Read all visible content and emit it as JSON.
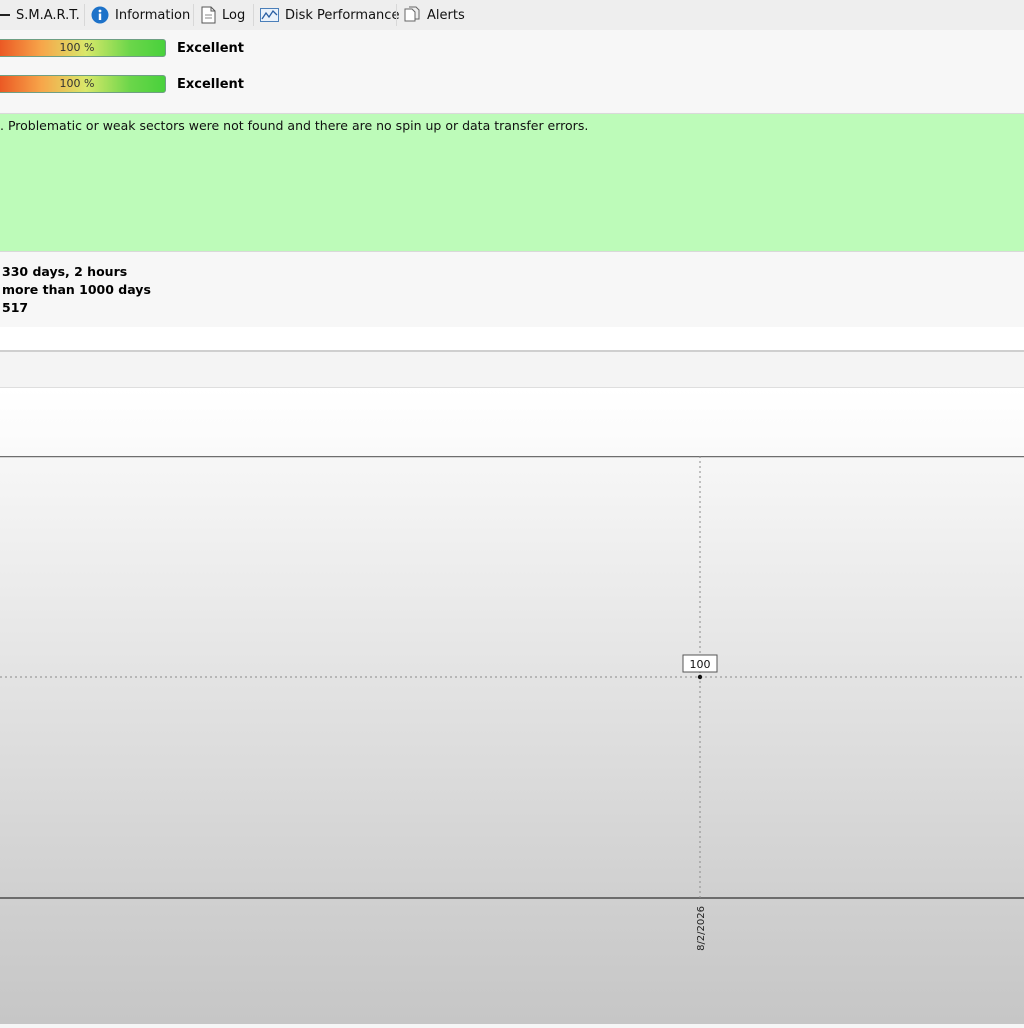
{
  "tabs": [
    {
      "label": "S.M.A.R.T.",
      "icon": "dash-icon"
    },
    {
      "label": "Information",
      "icon": "info-icon"
    },
    {
      "label": "Log",
      "icon": "document-icon"
    },
    {
      "label": "Disk Performance",
      "icon": "performance-chart-icon"
    },
    {
      "label": "Alerts",
      "icon": "alerts-icon"
    }
  ],
  "health": {
    "bars": [
      {
        "percent_text": "100 %",
        "fill": 1.0,
        "rating": "Excellent"
      },
      {
        "percent_text": "100 %",
        "fill": 1.0,
        "rating": "Excellent"
      }
    ]
  },
  "status": {
    "text": ". Problematic or weak sectors were not found and there are no spin up or data transfer errors.",
    "background": "#bdfbb9"
  },
  "stats": {
    "lines": [
      "330 days, 2 hours",
      "more than 1000 days",
      "517"
    ]
  },
  "chart_data": {
    "type": "line",
    "x": [
      "8/2/2026"
    ],
    "series": [
      {
        "values": [
          100
        ]
      }
    ],
    "data_labels": [
      "100"
    ],
    "grid": true
  }
}
